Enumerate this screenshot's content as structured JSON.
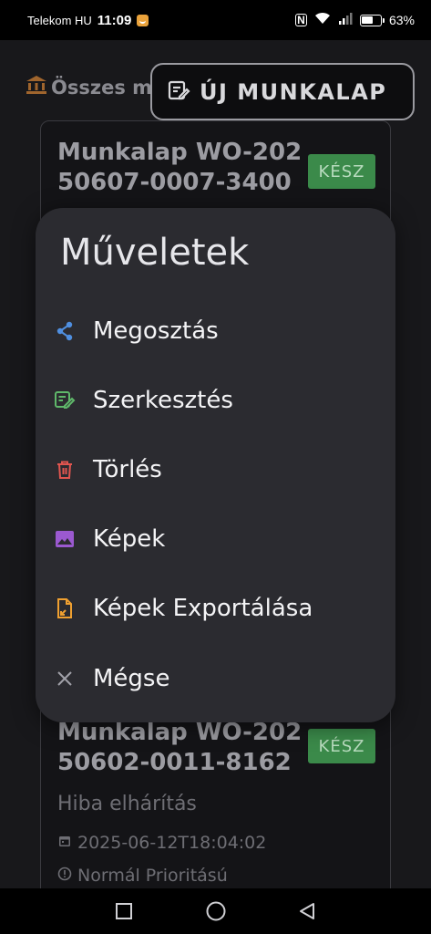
{
  "status_bar": {
    "carrier": "Telekom HU",
    "time": "11:09",
    "battery_percent": "63%",
    "battery_level": 0.63,
    "icons": [
      "app-notification-icon",
      "nfc-icon",
      "wifi-icon",
      "signal-icon",
      "battery-icon"
    ]
  },
  "header": {
    "title": "Összes m",
    "title_icon": "bank-icon",
    "new_button_label": "ÚJ MUNKALAP",
    "new_button_icon": "edit-note-icon"
  },
  "cards": [
    {
      "title": "Munkalap WO-20250607-0007-3400",
      "status": "KÉSZ"
    },
    {
      "title": "Munkalap WO-20250602-0011-8162",
      "status": "KÉSZ",
      "subtitle": "Hiba elhárítás",
      "date": "2025-06-12T18:04:02",
      "priority": "Normál Prioritású"
    }
  ],
  "sheet": {
    "title": "Műveletek",
    "items": [
      {
        "label": "Megosztás",
        "icon": "share-icon",
        "color": "#4f8fe0"
      },
      {
        "label": "Szerkesztés",
        "icon": "edit-icon",
        "color": "#5fb86a"
      },
      {
        "label": "Törlés",
        "icon": "trash-icon",
        "color": "#e0554f"
      },
      {
        "label": "Képek",
        "icon": "image-icon",
        "color": "#9b59d0"
      },
      {
        "label": "Képek Exportálása",
        "icon": "export-file-icon",
        "color": "#f0a030"
      },
      {
        "label": "Mégse",
        "icon": "close-icon",
        "color": "#a0a0a8"
      }
    ]
  },
  "nav_bar": {
    "buttons": [
      "recents-square-icon",
      "home-circle-icon",
      "back-triangle-icon"
    ]
  },
  "colors": {
    "badge_green": "#3b8a4a",
    "sheet_bg": "#2b2b30",
    "app_bg": "#18181b"
  }
}
